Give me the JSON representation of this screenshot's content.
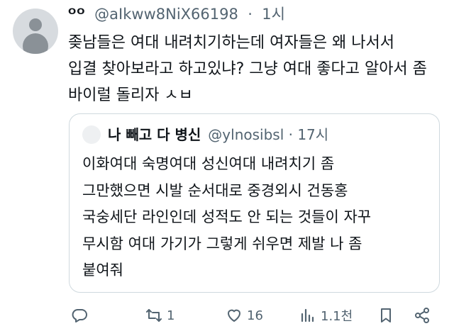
{
  "tweet": {
    "display_name": "ᴼᴼ",
    "handle": "@aIkww8NiX66198",
    "dot": "·",
    "time": "1시",
    "lines": [
      "좆남들은 여대 내려치기하는데 여자들은 왜 나서서",
      "입결 찾아보라고 하고있냐? 그냥 여대 좋다고 알아서 좀",
      "바이럴 돌리자 ㅅㅂ"
    ]
  },
  "quote": {
    "display_name": "나 빼고 다 병신",
    "handle": "@ylnosibsl",
    "dot": "·",
    "time": "17시",
    "lines": [
      "이화여대 숙명여대 성신여대 내려치기 좀",
      "그만했으면 시발 순서대로 중경외시 건동홍",
      "국숭세단 라인인데 성적도 안 되는 것들이 자꾸",
      "무시함 여대 가기가 그렇게 쉬우면 제발 나 좀",
      "붙여줘"
    ]
  },
  "actions": {
    "reply": {
      "icon": "reply-icon",
      "count": ""
    },
    "retweet": {
      "icon": "retweet-icon",
      "count": "1"
    },
    "like": {
      "icon": "heart-icon",
      "count": "16"
    },
    "views": {
      "icon": "views-icon",
      "count": "1.1천"
    },
    "bookmark": {
      "icon": "bookmark-icon"
    },
    "share": {
      "icon": "share-icon"
    }
  },
  "colors": {
    "text": "#0f1419",
    "muted": "#536471",
    "border": "#cfd9de"
  }
}
